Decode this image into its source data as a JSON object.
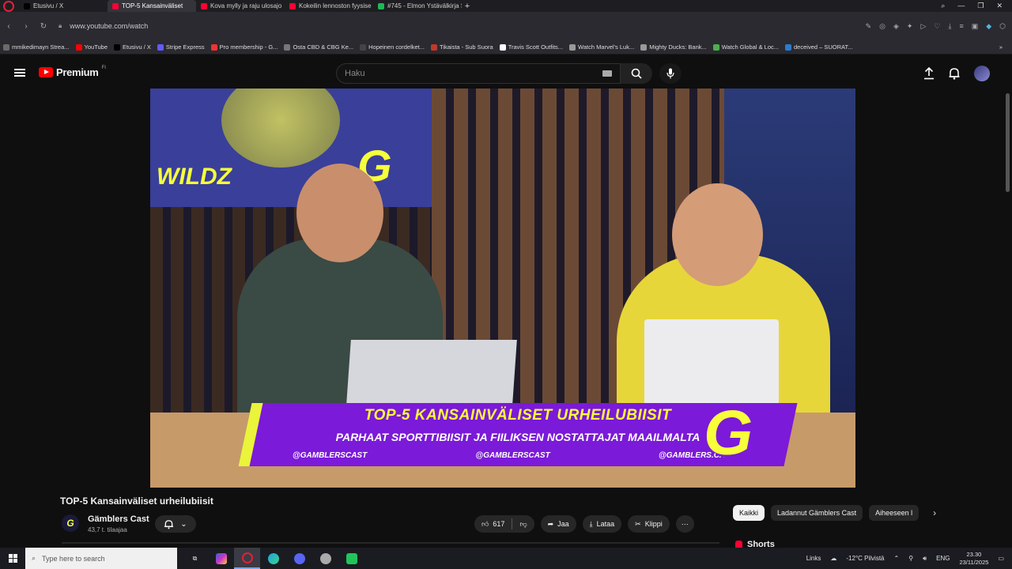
{
  "browser": {
    "tabs": [
      {
        "label": "Etusivu / X",
        "icon_color": "#000000"
      },
      {
        "label": "TOP-5 Kansainväliset",
        "icon_color": "#ff0033",
        "active": true
      },
      {
        "label": "Kova mylly ja raju ulosajo",
        "icon_color": "#ff0033"
      },
      {
        "label": "Kokeilin lennoston fyysise",
        "icon_color": "#ff0033"
      },
      {
        "label": "#745 - Elmon Ystävälkirja S",
        "icon_color": "#1db954"
      }
    ],
    "new_tab": "+",
    "url": "www.youtube.com/watch",
    "bookmarks": [
      {
        "label": "mmikedimayn Strea...",
        "color": "#6a6a6a"
      },
      {
        "label": "YouTube",
        "color": "#ff0000"
      },
      {
        "label": "Etusivu / X",
        "color": "#000000"
      },
      {
        "label": "Stripe Express",
        "color": "#635bff"
      },
      {
        "label": "Pro membership - G...",
        "color": "#e33"
      },
      {
        "label": "Osta CBD & CBG Ke...",
        "color": "#777"
      },
      {
        "label": "Hopeinen cordelket...",
        "color": "#444"
      },
      {
        "label": "Tikaista - Sub Suora",
        "color": "#c0392b"
      },
      {
        "label": "Travis Scott Outfits...",
        "color": "#fff"
      },
      {
        "label": "Watch Marvel's Luk...",
        "color": "#999"
      },
      {
        "label": "Mighty Ducks: Bank...",
        "color": "#999"
      },
      {
        "label": "Watch Global & Loc...",
        "color": "#4caf50"
      },
      {
        "label": "deceived – SUORAT...",
        "color": "#2a7bd0"
      }
    ]
  },
  "youtube": {
    "brand": "Premium",
    "brand_sup": "FI",
    "search_placeholder": "Haku",
    "video": {
      "banner_line1": "TOP-5 KANSAINVÄLISET URHEILUBIISIT",
      "banner_line2": "PARHAAT SPORTTIBIISIT JA FIILIKSEN NOSTATTAJAT MAAILMALTA",
      "socials": [
        "@GAMBLERSCAST",
        "@GAMBLERSCAST",
        "@GAMBLERS.CAST"
      ],
      "poster_text": "WILDZ",
      "logo_letter": "G"
    },
    "title": "TOP-5 Kansainväliset urheilubiisit",
    "channel": {
      "name": "Gämblers Cast",
      "subs": "43,7 t. tilaajaa",
      "avatar_letter": "G"
    },
    "actions": {
      "likes": "617",
      "share": "Jaa",
      "download": "Lataa",
      "clip": "Klippi",
      "more": "⋯"
    },
    "chips": [
      "Kaikki",
      "Ladannut Gämblers Cast",
      "Aiheeseen l"
    ],
    "shorts_label": "Shorts"
  },
  "taskbar": {
    "search_placeholder": "Type here to search",
    "links": "Links",
    "weather": "-12°C  Pilvistä",
    "lang": "ENG",
    "time": "23.30",
    "date": "23/11/2025"
  }
}
